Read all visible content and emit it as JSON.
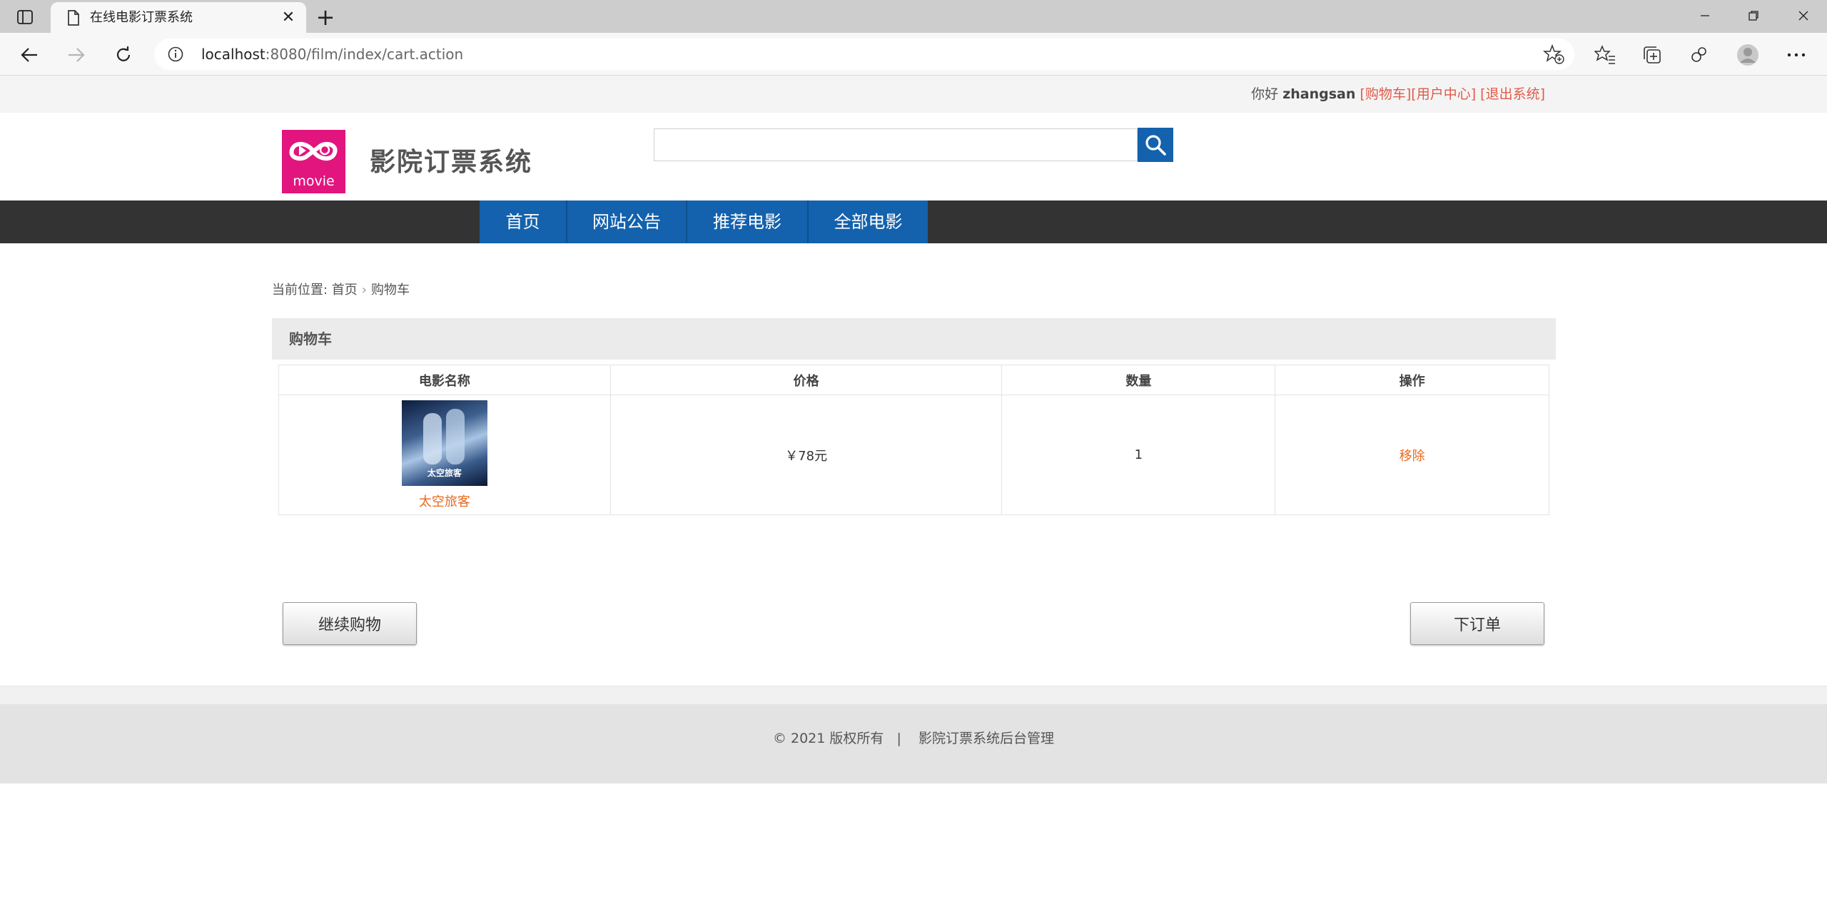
{
  "browser": {
    "tab_title": "在线电影订票系统",
    "url_host": "localhost",
    "url_rest": ":8080/film/index/cart.action"
  },
  "topbar": {
    "hello": "你好",
    "username": "zhangsan",
    "cart_link": "[购物车]",
    "user_center_link": "[用户中心]",
    "logout_link": "[退出系统]"
  },
  "header": {
    "logo_text": "movie",
    "site_title": "影院订票系统"
  },
  "nav": {
    "items": [
      {
        "label": "首页"
      },
      {
        "label": "网站公告"
      },
      {
        "label": "推荐电影"
      },
      {
        "label": "全部电影"
      }
    ]
  },
  "breadcrumb": {
    "prefix": "当前位置: ",
    "home": "首页",
    "current": "购物车"
  },
  "cart": {
    "title": "购物车",
    "columns": [
      "电影名称",
      "价格",
      "数量",
      "操作"
    ],
    "rows": [
      {
        "film": "太空旅客",
        "poster_text": "太空旅客",
        "price": "￥78元",
        "quantity": "1",
        "action": "移除"
      }
    ],
    "continue_label": "继续购物",
    "order_label": "下订单"
  },
  "footer": {
    "text": "© 2021 版权所有   |    影院订票系统后台管理"
  },
  "colors": {
    "nav_active": "#1462ad",
    "nav_bar": "#333333",
    "logo_bg": "#e2157e",
    "link_orange": "#e86a1e",
    "topbar_link": "#e05a4a"
  },
  "icons": {
    "sidebar": "sidebar-toggle-icon",
    "doc": "document-icon",
    "close": "close-icon",
    "new_tab": "plus-icon",
    "back": "arrow-left-icon",
    "forward": "arrow-right-icon",
    "refresh": "refresh-icon",
    "info": "info-icon",
    "search": "search-icon"
  }
}
